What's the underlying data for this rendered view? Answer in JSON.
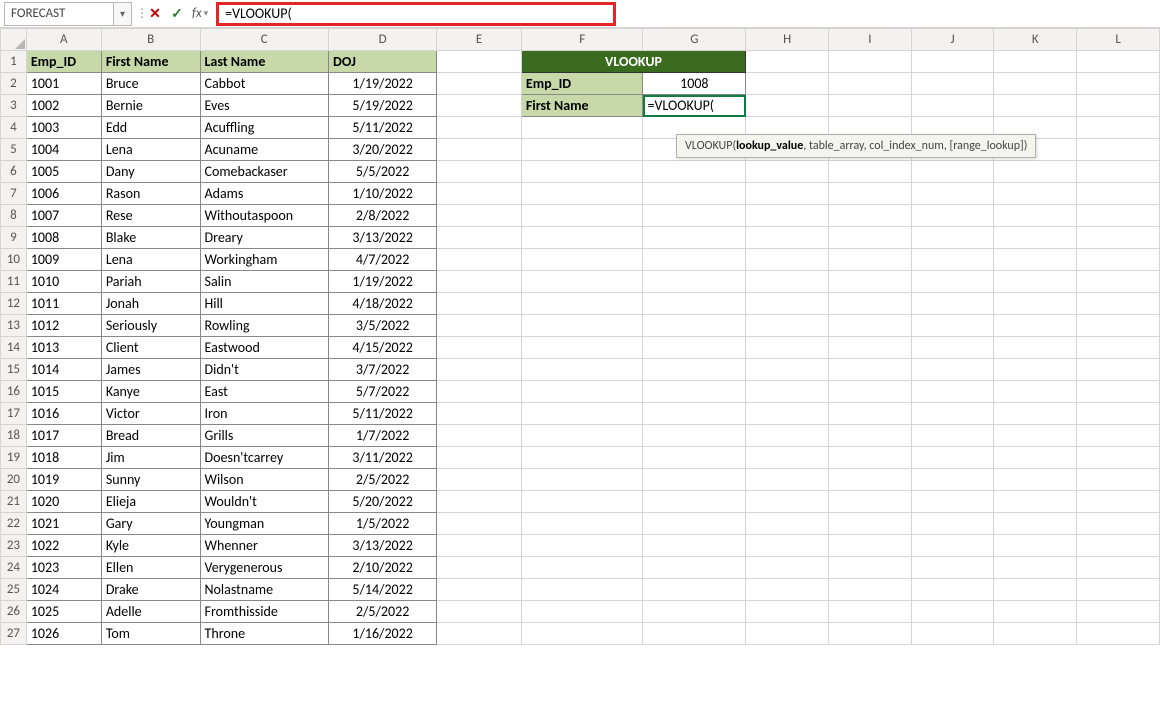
{
  "name_box": "FORECAST",
  "formula_bar": "=VLOOKUP(",
  "tooltip": {
    "fn": "VLOOKUP(",
    "arg1": "lookup_value",
    "rest": ", table_array, col_index_num, [range_lookup])"
  },
  "columns": [
    "A",
    "B",
    "C",
    "D",
    "E",
    "F",
    "G",
    "H",
    "I",
    "J",
    "K",
    "L"
  ],
  "data_headers": [
    "Emp_ID",
    "First Name",
    "Last Name",
    "DOJ"
  ],
  "rows": [
    {
      "id": "1001",
      "fn": "Bruce",
      "ln": "Cabbot",
      "doj": "1/19/2022"
    },
    {
      "id": "1002",
      "fn": "Bernie",
      "ln": "Eves",
      "doj": "5/19/2022"
    },
    {
      "id": "1003",
      "fn": "Edd",
      "ln": "Acuffling",
      "doj": "5/11/2022"
    },
    {
      "id": "1004",
      "fn": "Lena",
      "ln": "Acuname",
      "doj": "3/20/2022"
    },
    {
      "id": "1005",
      "fn": "Dany",
      "ln": "Comebackaser",
      "doj": "5/5/2022"
    },
    {
      "id": "1006",
      "fn": "Rason",
      "ln": "Adams",
      "doj": "1/10/2022"
    },
    {
      "id": "1007",
      "fn": "Rese",
      "ln": "Withoutaspoon",
      "doj": "2/8/2022"
    },
    {
      "id": "1008",
      "fn": "Blake",
      "ln": "Dreary",
      "doj": "3/13/2022"
    },
    {
      "id": "1009",
      "fn": "Lena",
      "ln": "Workingham",
      "doj": "4/7/2022"
    },
    {
      "id": "1010",
      "fn": "Pariah",
      "ln": "Salin",
      "doj": "1/19/2022"
    },
    {
      "id": "1011",
      "fn": "Jonah",
      "ln": "Hill",
      "doj": "4/18/2022"
    },
    {
      "id": "1012",
      "fn": "Seriously",
      "ln": "Rowling",
      "doj": "3/5/2022"
    },
    {
      "id": "1013",
      "fn": "Client",
      "ln": "Eastwood",
      "doj": "4/15/2022"
    },
    {
      "id": "1014",
      "fn": "James",
      "ln": "Didn't",
      "doj": "3/7/2022"
    },
    {
      "id": "1015",
      "fn": "Kanye",
      "ln": "East",
      "doj": "5/7/2022"
    },
    {
      "id": "1016",
      "fn": "Victor",
      "ln": "Iron",
      "doj": "5/11/2022"
    },
    {
      "id": "1017",
      "fn": "Bread",
      "ln": "Grills",
      "doj": "1/7/2022"
    },
    {
      "id": "1018",
      "fn": "Jim",
      "ln": "Doesn'tcarrey",
      "doj": "3/11/2022"
    },
    {
      "id": "1019",
      "fn": "Sunny",
      "ln": "Wilson",
      "doj": "2/5/2022"
    },
    {
      "id": "1020",
      "fn": "Elieja",
      "ln": "Wouldn't",
      "doj": "5/20/2022"
    },
    {
      "id": "1021",
      "fn": "Gary",
      "ln": "Youngman",
      "doj": "1/5/2022"
    },
    {
      "id": "1022",
      "fn": "Kyle",
      "ln": "Whenner",
      "doj": "3/13/2022"
    },
    {
      "id": "1023",
      "fn": "Ellen",
      "ln": "Verygenerous",
      "doj": "2/10/2022"
    },
    {
      "id": "1024",
      "fn": "Drake",
      "ln": "Nolastname",
      "doj": "5/14/2022"
    },
    {
      "id": "1025",
      "fn": "Adelle",
      "ln": "Fromthisside",
      "doj": "2/5/2022"
    },
    {
      "id": "1026",
      "fn": "Tom",
      "ln": "Throne",
      "doj": "1/16/2022"
    }
  ],
  "side": {
    "title": "VLOOKUP",
    "labels": {
      "emp": "Emp_ID",
      "fn": "First Name"
    },
    "emp_val": "1008",
    "fn_val": "=VLOOKUP("
  }
}
